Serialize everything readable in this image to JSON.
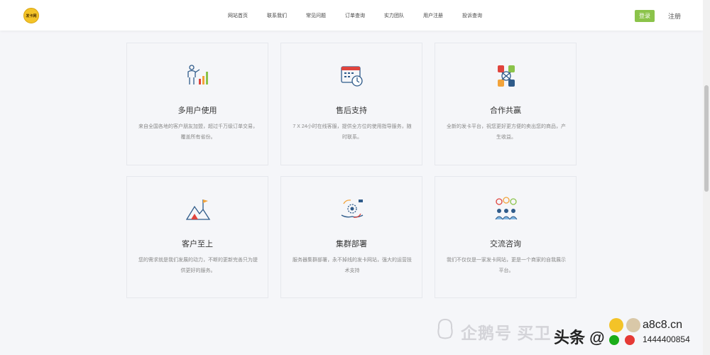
{
  "header": {
    "logo_text": "发卡网",
    "nav": [
      "网站首页",
      "联系我们",
      "常见问题",
      "订单查询",
      "实力团队",
      "用户注册",
      "投诉查询"
    ],
    "login_label": "登录",
    "register_label": "注册"
  },
  "features": [
    {
      "title": "多用户使用",
      "desc": "来自全国各地的客户朋友加盟，超过千万级订单交易，覆盖所有省份。",
      "icon": "presentation-chart-icon"
    },
    {
      "title": "售后支持",
      "desc": "7 X 24小时在线客服，提供全方位的使用指导服务，随时联系。",
      "icon": "calendar-clock-icon"
    },
    {
      "title": "合作共赢",
      "desc": "全新的发卡平台，祝您更好更方便的卖出您的商品，产生收益。",
      "icon": "handshake-icon"
    },
    {
      "title": "客户至上",
      "desc": "您的需求就是我们发展的动力，不断的更新完善只为提供更好的服务。",
      "icon": "mountain-flag-icon"
    },
    {
      "title": "集群部署",
      "desc": "服务器集群部署，永不掉线的发卡网站，强大的运营技术支持",
      "icon": "gear-hands-icon"
    },
    {
      "title": "交流咨询",
      "desc": "我们不仅仅是一家发卡网站，更是一个商家的自我展示平台。",
      "icon": "people-chat-icon"
    }
  ],
  "watermark": {
    "text": "企鹅号 买卫",
    "toutiao": "头条 @",
    "site": "a8c8.cn",
    "id": "1444400854"
  },
  "colors": {
    "accent": "#8bc34a",
    "icon_blue": "#2f5b8a",
    "icon_red": "#e0443d"
  }
}
